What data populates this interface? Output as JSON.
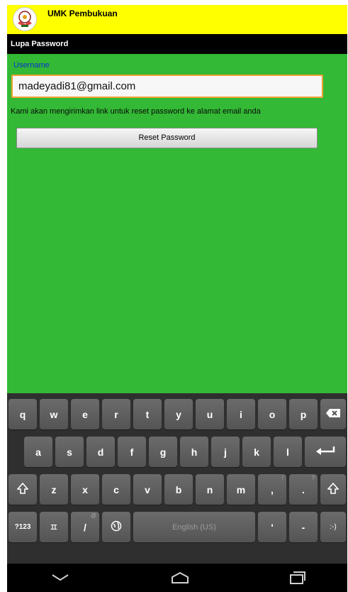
{
  "app": {
    "title": "UMK Pembukuan",
    "logo_color": "#8a1a1a"
  },
  "screen": {
    "title": "Lupa Password"
  },
  "form": {
    "username_label": "Username",
    "username_value": "madeyadi81@gmail.com",
    "hint": "Kami akan mengirimkan link untuk reset password ke alamat email anda",
    "reset_button_label": "Reset Password"
  },
  "keyboard": {
    "row1": [
      "q",
      "w",
      "e",
      "r",
      "t",
      "y",
      "u",
      "i",
      "o",
      "p"
    ],
    "row2": [
      "a",
      "s",
      "d",
      "f",
      "g",
      "h",
      "j",
      "k",
      "l"
    ],
    "row3": [
      "z",
      "x",
      "c",
      "v",
      "b",
      "n",
      "m",
      ",",
      "."
    ],
    "row3_subs": [
      ",",
      "!",
      "?"
    ],
    "numbers_key": "?123",
    "symbol_key": "ㅍ",
    "slash_key": "/",
    "slash_sub": "@",
    "space_label": "English (US)",
    "apostrophe_key": "'",
    "dash_key": "-",
    "smiley_key": ":-)"
  },
  "colors": {
    "accent": "#ffff00",
    "content_bg": "#33b935",
    "input_border": "#f0a033"
  }
}
